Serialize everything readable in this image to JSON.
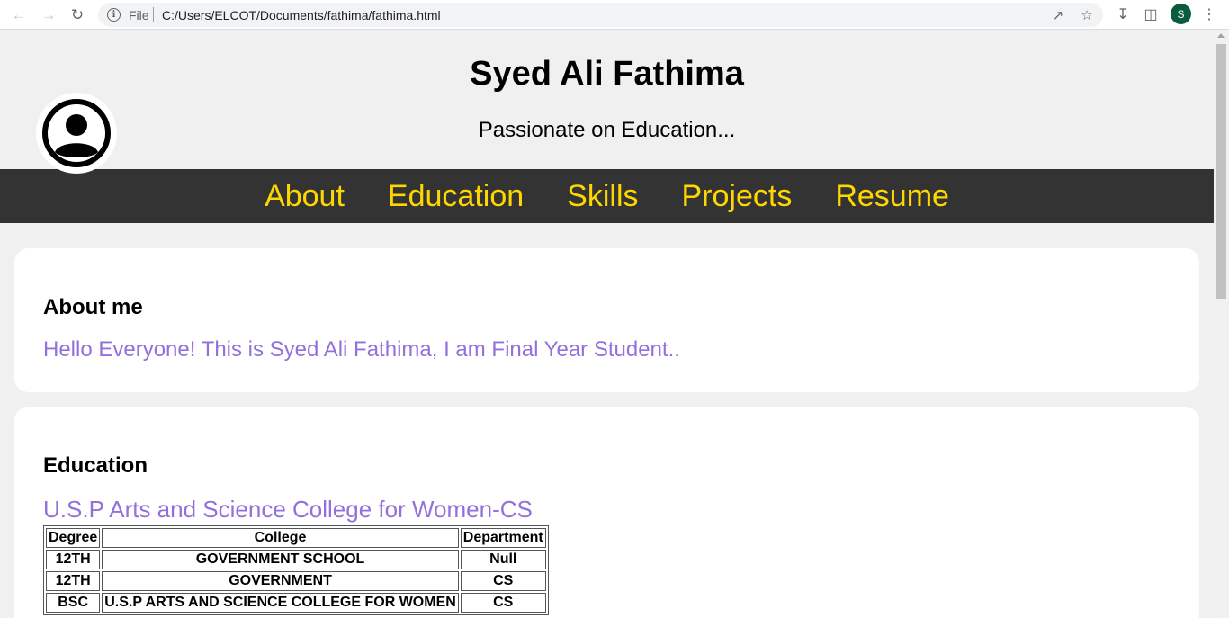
{
  "browser": {
    "file_label": "File",
    "url": "C:/Users/ELCOT/Documents/fathima/fathima.html",
    "profile_initial": "S"
  },
  "header": {
    "title": "Syed Ali Fathima",
    "tagline": "Passionate on Education..."
  },
  "nav": {
    "items": [
      "About",
      "Education",
      "Skills",
      "Projects",
      "Resume"
    ]
  },
  "about": {
    "heading": "About me",
    "text": "Hello Everyone! This is Syed Ali Fathima, I am Final Year Student.."
  },
  "education": {
    "heading": "Education",
    "subtitle": "U.S.P Arts and Science College for Women-CS",
    "columns": [
      "Degree",
      "College",
      "Department"
    ],
    "rows": [
      [
        "12TH",
        "GOVERNMENT SCHOOL",
        "Null"
      ],
      [
        "12TH",
        "GOVERNMENT",
        "CS"
      ],
      [
        "BSC",
        "U.S.P ARTS AND SCIENCE COLLEGE FOR WOMEN",
        "CS"
      ]
    ]
  },
  "colors": {
    "nav_bg": "#333333",
    "nav_text": "#ffd700",
    "accent_text": "#9370db"
  }
}
